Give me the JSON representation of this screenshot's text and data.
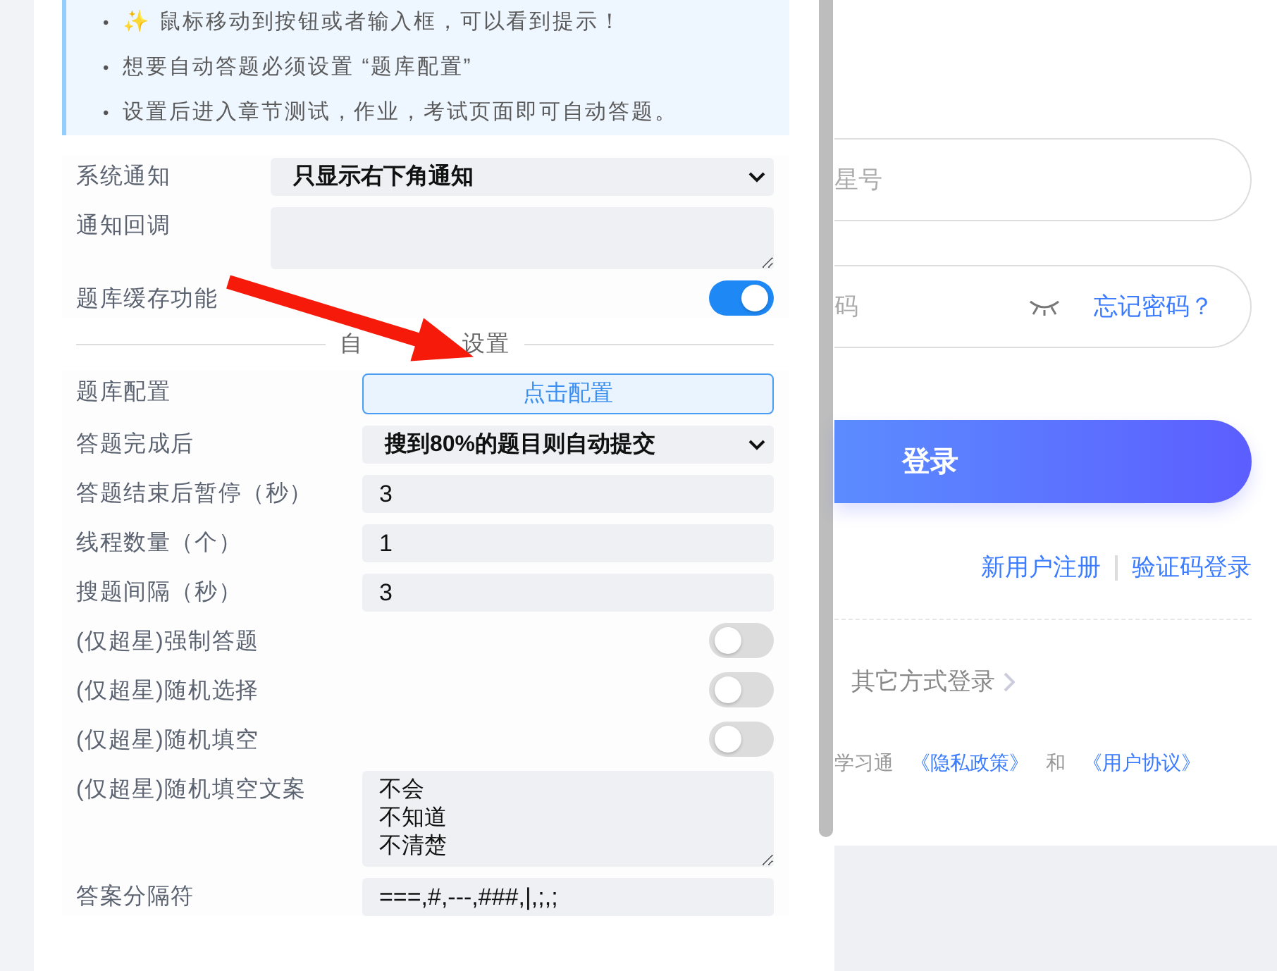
{
  "tips": [
    {
      "bullet": "•",
      "text": "✨ 鼠标移动到按钮或者输入框，可以看到提示！"
    },
    {
      "bullet": "•",
      "text": "想要自动答题必须设置 “题库配置”"
    },
    {
      "bullet": "•",
      "text": "设置后进入章节测试，作业，考试页面即可自动答题。"
    }
  ],
  "notify_settings": [
    {
      "kind": "select",
      "label": "系统通知",
      "value": "只显示右下角通知"
    },
    {
      "kind": "textarea",
      "label": "通知回调"
    },
    {
      "kind": "toggle",
      "label": "题库缓存功能",
      "on": true
    }
  ],
  "section_title": [
    "自",
    "设置"
  ],
  "answer_settings": [
    {
      "kind": "button",
      "label": "题库配置",
      "value": "点击配置"
    },
    {
      "kind": "select",
      "label": "答题完成后",
      "value": "搜到80%的题目则自动提交"
    },
    {
      "kind": "input",
      "label": "答题结束后暂停（秒）",
      "value": "3"
    },
    {
      "kind": "input",
      "label": "线程数量（个）",
      "value": "1"
    },
    {
      "kind": "input",
      "label": "搜题间隔（秒）",
      "value": "3"
    },
    {
      "kind": "toggle",
      "label": "(仅超星)强制答题",
      "on": false
    },
    {
      "kind": "toggle",
      "label": "(仅超星)随机选择",
      "on": false
    },
    {
      "kind": "toggle",
      "label": "(仅超星)随机填空",
      "on": false
    },
    {
      "kind": "textarea",
      "label": "(仅超星)随机填空文案",
      "lines": [
        "不会",
        "不知道",
        "不清楚"
      ]
    },
    {
      "kind": "input",
      "label": "答案分隔符",
      "value": "===,#,---,###,|,;,;"
    }
  ],
  "login": {
    "account_placeholder": "星号",
    "password_placeholder": "码",
    "forgot": "忘记密码？",
    "button": "登录",
    "links": [
      "新用户注册",
      "验证码登录"
    ],
    "other_login": "其它方式登录",
    "terms": [
      {
        "kind": "text",
        "text": "学习通"
      },
      {
        "kind": "link",
        "text": "《隐私政策》"
      },
      {
        "kind": "text",
        "text": "和"
      },
      {
        "kind": "link",
        "text": "《用户协议》"
      }
    ]
  }
}
